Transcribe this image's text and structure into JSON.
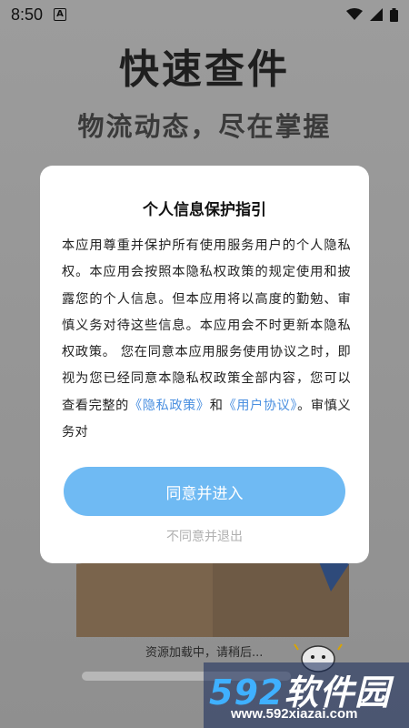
{
  "status_bar": {
    "time": "8:50",
    "badge": "A",
    "icons": [
      "wifi-icon",
      "signal-icon",
      "battery-icon"
    ]
  },
  "background": {
    "headline": "快速查件",
    "subheadline": "物流动态，尽在掌握",
    "loading_text": "资源加载中，请稍后..."
  },
  "dialog": {
    "title": "个人信息保护指引",
    "body_text": "本应用尊重并保护所有使用服务用户的个人隐私权。本应用会按照本隐私权政策的规定使用和披露您的个人信息。但本应用将以高度的勤勉、审慎义务对待这些信息。本应用会不时更新本隐私权政策。 您在同意本应用服务使用协议之时，即视为您已经同意本隐私权政策全部内容，您可以查看完整的",
    "privacy_link": "《隐私政策》",
    "and_text": "和",
    "terms_link": "《用户协议》",
    "tail_text": "。审慎义务对",
    "agree_label": "同意并进入",
    "decline_label": "不同意并退出"
  },
  "watermark": {
    "number": "592",
    "name": "软件园",
    "url": "www.592xiazai.com"
  },
  "colors": {
    "accent": "#6fbaf3",
    "link": "#4a8fe0",
    "overlay": "#9a9a9a"
  }
}
